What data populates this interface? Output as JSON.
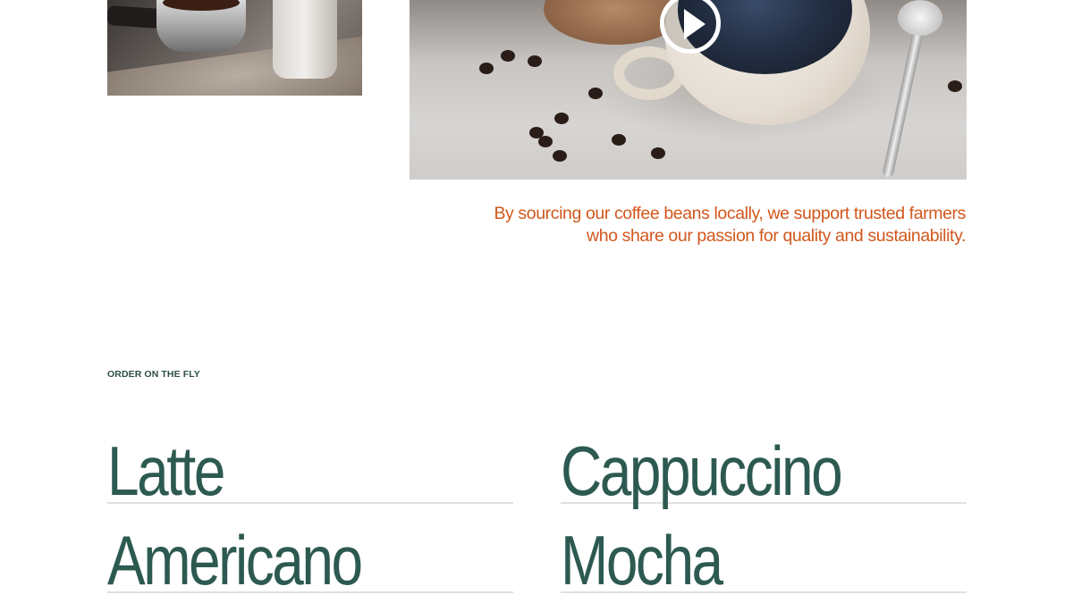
{
  "media": {
    "espresso_image": "portafilter-photo",
    "coffee_image": "coffee-cup-photo",
    "play_icon": "play-icon"
  },
  "quote": {
    "text": "By sourcing our coffee beans locally, we support trusted farmers who share our passion for quality and sustainability."
  },
  "order_section": {
    "label": "ORDER ON THE FLY",
    "items": [
      {
        "label": "Latte"
      },
      {
        "label": "Cappuccino"
      },
      {
        "label": "Americano"
      },
      {
        "label": "Mocha"
      }
    ]
  },
  "colors": {
    "accent": "#d2571c",
    "primary_text": "#2d5a50",
    "divider": "#dfe1e0"
  }
}
